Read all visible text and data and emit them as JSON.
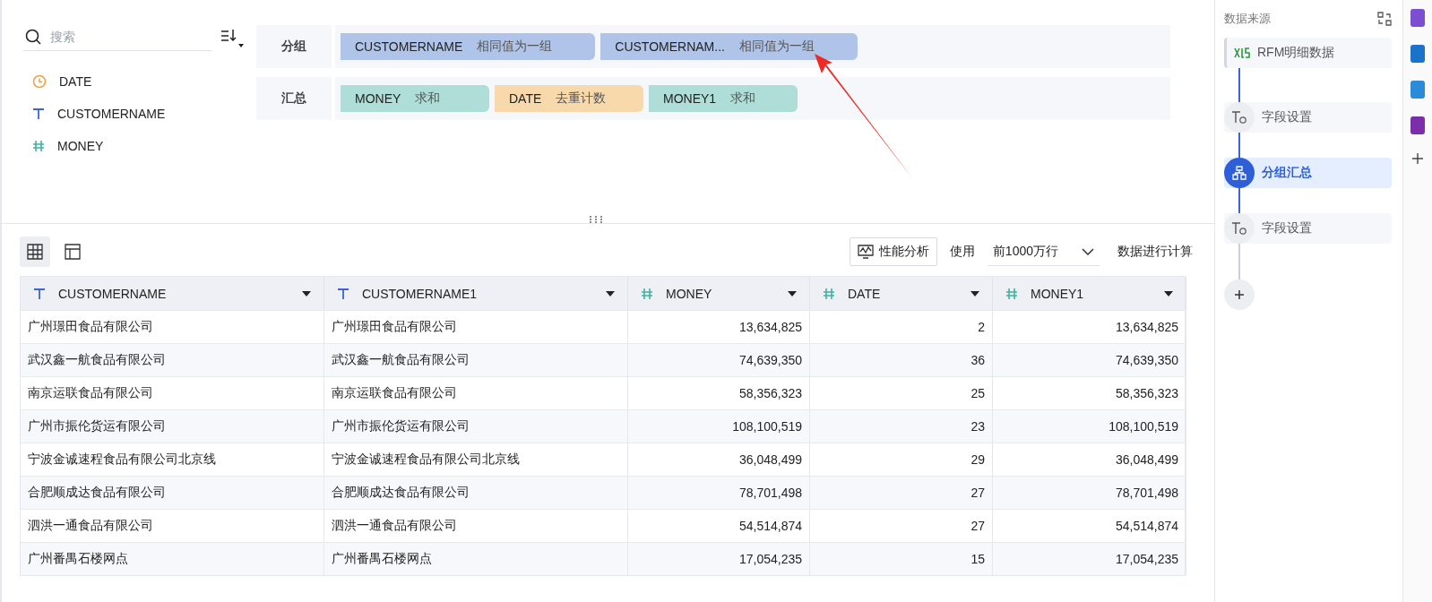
{
  "search": {
    "placeholder": "搜索"
  },
  "fields": [
    {
      "name": "DATE",
      "kind": "date"
    },
    {
      "name": "CUSTOMERNAME",
      "kind": "text"
    },
    {
      "name": "MONEY",
      "kind": "number"
    }
  ],
  "groups": [
    {
      "label": "分组",
      "chips": [
        {
          "field": "CUSTOMERNAME",
          "agg": "相同值为一组",
          "color": "#afc4e8"
        },
        {
          "field": "CUSTOMERNAM...",
          "agg": "相同值为一组",
          "color": "#afc4e8"
        }
      ]
    },
    {
      "label": "汇总",
      "chips": [
        {
          "field": "MONEY",
          "agg": "求和",
          "color": "#afded8"
        },
        {
          "field": "DATE",
          "agg": "去重计数",
          "color": "#f8d9ac"
        },
        {
          "field": "MONEY1",
          "agg": "求和",
          "color": "#afded8"
        }
      ]
    }
  ],
  "views": [
    {
      "selected": true
    },
    {
      "selected": false
    }
  ],
  "toolbar": {
    "perf_button": "性能分析",
    "use_label": "使用",
    "row_limit": "前1000万行",
    "suffix": "数据进行计算"
  },
  "table": {
    "columns": [
      {
        "name": "CUSTOMERNAME",
        "kind": "text"
      },
      {
        "name": "CUSTOMERNAME1",
        "kind": "text"
      },
      {
        "name": "MONEY",
        "kind": "number"
      },
      {
        "name": "DATE",
        "kind": "number"
      },
      {
        "name": "MONEY1",
        "kind": "number"
      }
    ],
    "rows": [
      [
        "广州璟田食品有限公司",
        "广州璟田食品有限公司",
        "13,634,825",
        "2",
        "13,634,825"
      ],
      [
        "武汉鑫一航食品有限公司",
        "武汉鑫一航食品有限公司",
        "74,639,350",
        "36",
        "74,639,350"
      ],
      [
        "南京运联食品有限公司",
        "南京运联食品有限公司",
        "58,356,323",
        "25",
        "58,356,323"
      ],
      [
        "广州市振伦货运有限公司",
        "广州市振伦货运有限公司",
        "108,100,519",
        "23",
        "108,100,519"
      ],
      [
        "宁波金诚速程食品有限公司北京线",
        "宁波金诚速程食品有限公司北京线",
        "36,048,499",
        "29",
        "36,048,499"
      ],
      [
        "合肥顺成达食品有限公司",
        "合肥顺成达食品有限公司",
        "78,701,498",
        "27",
        "78,701,498"
      ],
      [
        "泗洪一通食品有限公司",
        "泗洪一通食品有限公司",
        "54,514,874",
        "27",
        "54,514,874"
      ],
      [
        "广州番禺石楼网点",
        "广州番禺石楼网点",
        "17,054,235",
        "15",
        "17,054,235"
      ]
    ]
  },
  "panel": {
    "title": "数据来源",
    "steps": [
      {
        "kind": "source",
        "label": "RFM明细数据",
        "selected": false
      },
      {
        "kind": "step",
        "label": "字段设置",
        "selected": false
      },
      {
        "kind": "group",
        "label": "分组汇总",
        "selected": true
      },
      {
        "kind": "step",
        "label": "字段设置",
        "selected": false
      },
      {
        "kind": "add",
        "selected": false
      }
    ]
  }
}
